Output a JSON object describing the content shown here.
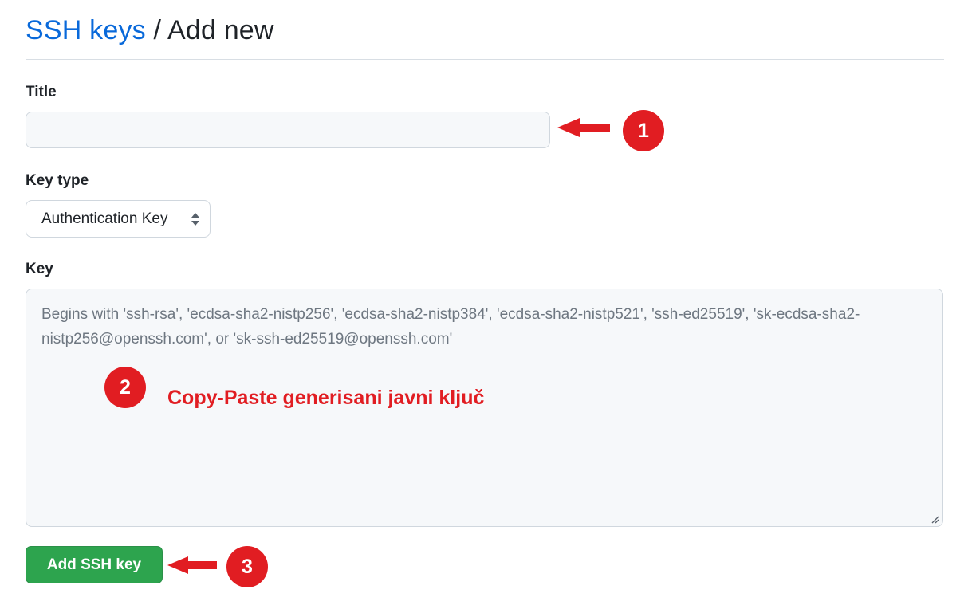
{
  "breadcrumb": {
    "link": "SSH keys",
    "separator": " / ",
    "current": "Add new"
  },
  "form": {
    "title_label": "Title",
    "title_value": "",
    "key_type_label": "Key type",
    "key_type_selected": "Authentication Key",
    "key_label": "Key",
    "key_placeholder": "Begins with 'ssh-rsa', 'ecdsa-sha2-nistp256', 'ecdsa-sha2-nistp384', 'ecdsa-sha2-nistp521', 'ssh-ed25519', 'sk-ecdsa-sha2-nistp256@openssh.com', or 'sk-ssh-ed25519@openssh.com'",
    "key_value": "",
    "submit_label": "Add SSH key"
  },
  "annotations": {
    "step1": "1",
    "step2": "2",
    "step3": "3",
    "step2_text": "Copy-Paste generisani javni ključ",
    "color": "#e11d22"
  },
  "colors": {
    "link": "#0969da",
    "primary_button": "#2da44e",
    "input_background": "#f6f8fa",
    "border": "#d0d7de"
  },
  "icons": {
    "select_indicator": "up-down-caret-icon",
    "resize": "resize-grip-icon",
    "annotation_arrow": "left-arrow-icon"
  }
}
